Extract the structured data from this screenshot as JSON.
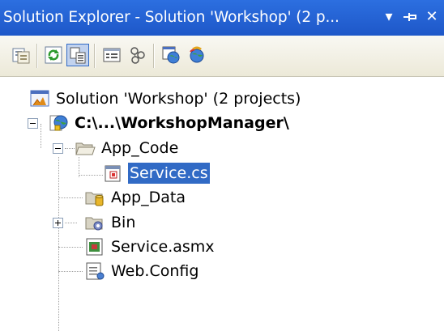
{
  "window": {
    "title": "Solution Explorer - Solution 'Workshop' (2 p...",
    "dropdown_glyph": "▾",
    "pin_glyph": "⊣",
    "close_glyph": "✕"
  },
  "toolbar": {
    "buttons": [
      {
        "icon": "properties-icon"
      },
      {
        "icon": "refresh-icon"
      },
      {
        "icon": "show-all-files-icon",
        "active": true
      },
      {
        "icon": "view-code-icon"
      },
      {
        "icon": "copy-website-icon"
      },
      {
        "icon": "view-in-browser-icon"
      },
      {
        "icon": "asp-net-configuration-icon"
      }
    ]
  },
  "tree": {
    "solution": {
      "label": "Solution 'Workshop' (2 projects)",
      "icon": "solution-icon"
    },
    "project": {
      "label": "C:\\...\\WorkshopManager\\",
      "icon": "web-project-icon",
      "expanded": true
    },
    "items": [
      {
        "label": "App_Code",
        "icon": "folder-open-icon",
        "expanded": true
      },
      {
        "label": "Service.cs",
        "icon": "csharp-file-icon",
        "selected": true
      },
      {
        "label": "App_Data",
        "icon": "data-folder-icon"
      },
      {
        "label": "Bin",
        "icon": "bin-folder-icon",
        "expanded": false
      },
      {
        "label": "Service.asmx",
        "icon": "asmx-file-icon"
      },
      {
        "label": "Web.Config",
        "icon": "config-file-icon"
      }
    ]
  },
  "colors": {
    "title_bar": "#1e57c8",
    "selection": "#316ac5"
  }
}
